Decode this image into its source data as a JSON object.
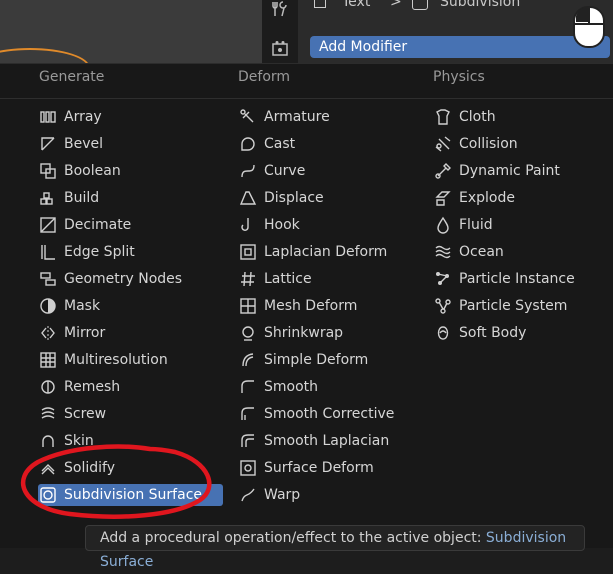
{
  "header": {
    "breadcrumb_1": "Text",
    "breadcrumb_sep": ">",
    "breadcrumb_2": "Subdivision",
    "add_modifier": "Add Modifier"
  },
  "menu": {
    "columns": [
      "Generate",
      "Deform",
      "Physics"
    ],
    "generate": [
      {
        "label": "Array",
        "icon": "array-icon"
      },
      {
        "label": "Bevel",
        "icon": "bevel-icon"
      },
      {
        "label": "Boolean",
        "icon": "boolean-icon"
      },
      {
        "label": "Build",
        "icon": "build-icon"
      },
      {
        "label": "Decimate",
        "icon": "decimate-icon"
      },
      {
        "label": "Edge Split",
        "icon": "edge-split-icon"
      },
      {
        "label": "Geometry Nodes",
        "icon": "geometry-nodes-icon"
      },
      {
        "label": "Mask",
        "icon": "mask-icon"
      },
      {
        "label": "Mirror",
        "icon": "mirror-icon"
      },
      {
        "label": "Multiresolution",
        "icon": "multires-icon"
      },
      {
        "label": "Remesh",
        "icon": "remesh-icon"
      },
      {
        "label": "Screw",
        "icon": "screw-icon"
      },
      {
        "label": "Skin",
        "icon": "skin-icon"
      },
      {
        "label": "Solidify",
        "icon": "solidify-icon"
      },
      {
        "label": "Subdivision Surface",
        "icon": "subsurf-icon",
        "selected": true
      }
    ],
    "deform": [
      {
        "label": "Armature",
        "icon": "armature-icon"
      },
      {
        "label": "Cast",
        "icon": "cast-icon"
      },
      {
        "label": "Curve",
        "icon": "curve-icon"
      },
      {
        "label": "Displace",
        "icon": "displace-icon"
      },
      {
        "label": "Hook",
        "icon": "hook-icon"
      },
      {
        "label": "Laplacian Deform",
        "icon": "laplacian-deform-icon"
      },
      {
        "label": "Lattice",
        "icon": "lattice-icon"
      },
      {
        "label": "Mesh Deform",
        "icon": "mesh-deform-icon"
      },
      {
        "label": "Shrinkwrap",
        "icon": "shrinkwrap-icon"
      },
      {
        "label": "Simple Deform",
        "icon": "simple-deform-icon"
      },
      {
        "label": "Smooth",
        "icon": "smooth-icon"
      },
      {
        "label": "Smooth Corrective",
        "icon": "smooth-corrective-icon"
      },
      {
        "label": "Smooth Laplacian",
        "icon": "smooth-laplacian-icon"
      },
      {
        "label": "Surface Deform",
        "icon": "surface-deform-icon"
      },
      {
        "label": "Warp",
        "icon": "warp-icon"
      }
    ],
    "physics": [
      {
        "label": "Cloth",
        "icon": "cloth-icon"
      },
      {
        "label": "Collision",
        "icon": "collision-icon"
      },
      {
        "label": "Dynamic Paint",
        "icon": "dynamic-paint-icon"
      },
      {
        "label": "Explode",
        "icon": "explode-icon"
      },
      {
        "label": "Fluid",
        "icon": "fluid-icon"
      },
      {
        "label": "Ocean",
        "icon": "ocean-icon"
      },
      {
        "label": "Particle Instance",
        "icon": "particle-instance-icon"
      },
      {
        "label": "Particle System",
        "icon": "particle-system-icon"
      },
      {
        "label": "Soft Body",
        "icon": "soft-body-icon"
      }
    ]
  },
  "tooltip": {
    "text": "Add a procedural operation/effect to the active object:",
    "highlight": "Subdivision Surface"
  },
  "colors": {
    "accent": "#4772b3",
    "annotation": "#e0161e",
    "outline": "#e08a2a"
  }
}
